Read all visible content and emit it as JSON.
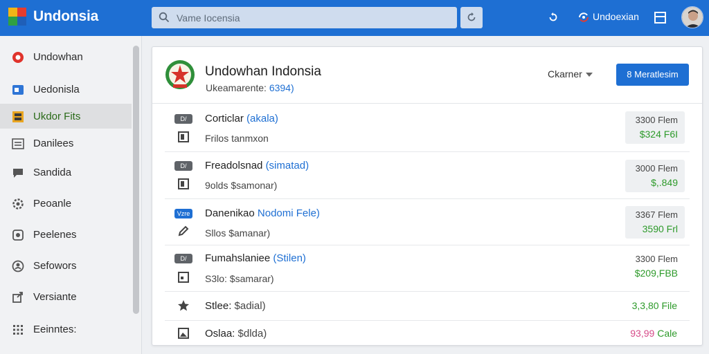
{
  "app": {
    "title": "Undonsia",
    "colors": {
      "primary": "#1e6fd3",
      "success": "#2d9a2a",
      "warning": "#d64b89"
    }
  },
  "search": {
    "placeholder": "Vame Iocensia"
  },
  "header": {
    "account_label": "Undoexian"
  },
  "sidebar": {
    "items": [
      {
        "label": "Undowhan",
        "icon": "record-icon"
      },
      {
        "label": "Uedonisla",
        "icon": "folder-icon"
      },
      {
        "label": "Ukdor Fits",
        "icon": "file-cabinet-icon",
        "active": true
      },
      {
        "label": "Danilees",
        "icon": "list-icon"
      },
      {
        "label": "Sandida",
        "icon": "chat-icon"
      },
      {
        "label": "Peoanle",
        "icon": "settings-icon"
      },
      {
        "label": "Peelenes",
        "icon": "gallery-icon"
      },
      {
        "label": "Sefowors",
        "icon": "person-icon"
      },
      {
        "label": "Versiante",
        "icon": "share-icon"
      },
      {
        "label": "Eeinntes:",
        "icon": "grid-icon"
      }
    ]
  },
  "card": {
    "title": "Undowhan Indonsia",
    "subtitle_prefix": "Ukeamarente: ",
    "subtitle_accent": "6394)",
    "sort_label": "Ckarner",
    "primary_button": "Meratlesim"
  },
  "files": [
    {
      "badge": "D/",
      "name": "Corticlar",
      "tag": "(akala)",
      "sub": "Frilos tanmxon",
      "size_top": "3300 Flem",
      "size_bottom": "$324 F6I"
    },
    {
      "badge": "D/",
      "name": "Freadolsnad",
      "tag": "(simatad)",
      "sub": "9olds $samonar)",
      "size_top": "3000 Flem",
      "size_bottom": "$,.849"
    },
    {
      "badge": "Vzre",
      "name": "Danenikao",
      "tag": "Nodomi Fele)",
      "sub": "Sllos $amanar)",
      "size_top": "3367 Flem",
      "size_bottom": "3590 Frl"
    },
    {
      "badge": "D/",
      "name": "Fumahslaniee",
      "tag": "(Stilen)",
      "sub": "S3lo: $samarar)",
      "size_top": "3300 Flem",
      "size_bottom": "$209,FBB"
    },
    {
      "name": "Stlee:",
      "sub_inline": "$adial)",
      "size": "3,3,80 File"
    },
    {
      "name": "Oslaa:",
      "sub_inline": "$dlda)",
      "size_a": "93,99",
      "size_b": " Cale"
    }
  ]
}
